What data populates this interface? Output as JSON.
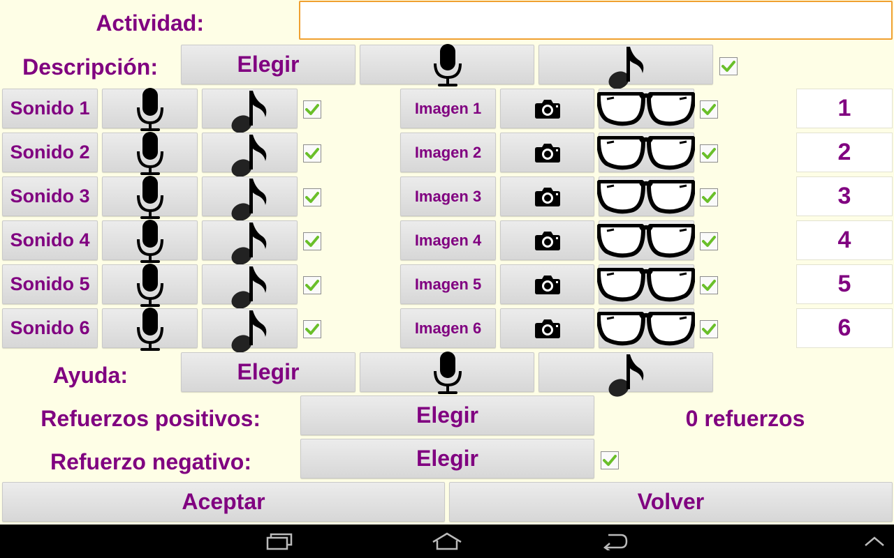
{
  "actividad": {
    "label": "Actividad:",
    "value": ""
  },
  "descripcion": {
    "label": "Descripción:",
    "choose_label": "Elegir",
    "checked": true
  },
  "rows": [
    {
      "sound_label": "Sonido 1",
      "image_label": "Imagen 1",
      "number": "1",
      "sound_checked": true,
      "image_checked": true
    },
    {
      "sound_label": "Sonido 2",
      "image_label": "Imagen 2",
      "number": "2",
      "sound_checked": true,
      "image_checked": true
    },
    {
      "sound_label": "Sonido 3",
      "image_label": "Imagen 3",
      "number": "3",
      "sound_checked": true,
      "image_checked": true
    },
    {
      "sound_label": "Sonido 4",
      "image_label": "Imagen 4",
      "number": "4",
      "sound_checked": true,
      "image_checked": true
    },
    {
      "sound_label": "Sonido 5",
      "image_label": "Imagen 5",
      "number": "5",
      "sound_checked": true,
      "image_checked": true
    },
    {
      "sound_label": "Sonido 6",
      "image_label": "Imagen 6",
      "number": "6",
      "sound_checked": true,
      "image_checked": true
    }
  ],
  "ayuda": {
    "label": "Ayuda:",
    "choose_label": "Elegir"
  },
  "refuerzos_positivos": {
    "label": "Refuerzos positivos:",
    "choose_label": "Elegir",
    "count_text": "0 refuerzos"
  },
  "refuerzo_negativo": {
    "label": "Refuerzo negativo:",
    "choose_label": "Elegir",
    "checked": true
  },
  "footer": {
    "accept_label": "Aceptar",
    "back_label": "Volver"
  },
  "icons": {
    "mic": "microphone-icon",
    "note": "music-note-icon",
    "camera": "camera-icon",
    "glasses": "glasses-icon",
    "check": "checkmark-icon",
    "nav_recent": "recent-apps-icon",
    "nav_home": "home-icon",
    "nav_back": "back-icon",
    "nav_up": "chevron-up-icon"
  },
  "colors": {
    "text": "#800080",
    "background": "#fefee6",
    "input_border": "#f0a030",
    "check": "#6abf2a"
  }
}
